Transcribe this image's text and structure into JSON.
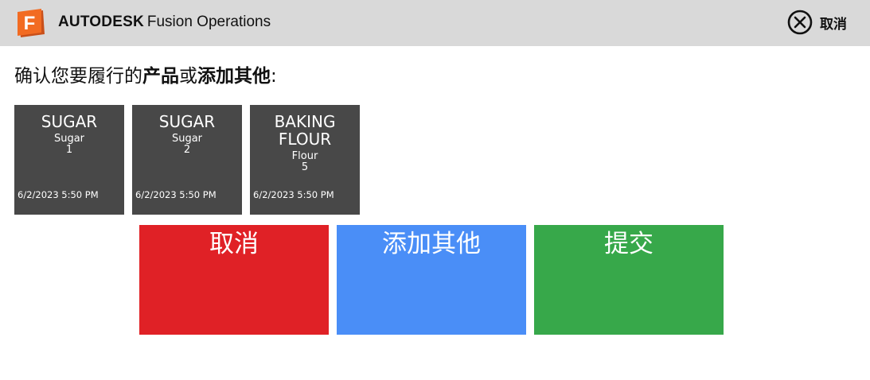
{
  "header": {
    "logo_letter": "F",
    "brand_bold": "AUTODESK",
    "brand_product": "Fusion Operations",
    "cancel_label": "取消"
  },
  "prompt": {
    "part1": "确认您要履行的",
    "bold1": "产品",
    "part2": "或",
    "bold2": "添加其他",
    "part3": ":"
  },
  "products": [
    {
      "name": "SUGAR",
      "material": "Sugar",
      "quantity": "1",
      "timestamp": "6/2/2023 5:50 PM"
    },
    {
      "name": "SUGAR",
      "material": "Sugar",
      "quantity": "2",
      "timestamp": "6/2/2023 5:50 PM"
    },
    {
      "name": "BAKING FLOUR",
      "material": "Flour",
      "quantity": "5",
      "timestamp": "6/2/2023 5:50 PM"
    }
  ],
  "actions": {
    "cancel_label": "取消",
    "add_other_label": "添加其他",
    "submit_label": "提交"
  },
  "colors": {
    "header_bg": "#d9d9d9",
    "tile_bg": "#484848",
    "cancel": "#e02126",
    "add_other": "#4a8ef7",
    "submit": "#37a84a",
    "logo_orange": "#f26b22"
  }
}
